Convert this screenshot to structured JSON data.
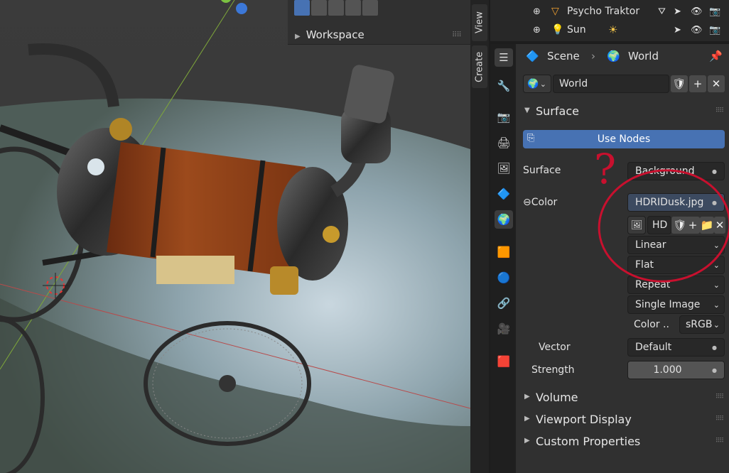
{
  "viewport": {
    "workspace_label": "Workspace"
  },
  "side_tabs": {
    "view": "View",
    "create": "Create"
  },
  "outliner": {
    "rows": [
      {
        "name": "Psycho Traktor"
      },
      {
        "name": "Sun"
      }
    ]
  },
  "properties": {
    "breadcrumb": {
      "scene": "Scene",
      "world": "World"
    },
    "world_name": "World",
    "surface_section": "Surface",
    "use_nodes_label": "Use Nodes",
    "surface_label": "Surface",
    "surface_value": "Background",
    "color_label": "Color",
    "color_value": "HDRIDusk.jpg",
    "image_name": "HD",
    "interpolation": "Linear",
    "projection": "Flat",
    "extension": "Repeat",
    "source": "Single Image",
    "color_space_label": "Color ..",
    "color_space_value": "sRGB",
    "vector_label": "Vector",
    "vector_value": "Default",
    "strength_label": "Strength",
    "strength_value": "1.000",
    "volume_section": "Volume",
    "viewport_display_section": "Viewport Display",
    "custom_properties_section": "Custom Properties"
  },
  "annotation": {
    "text": "?",
    "color": "#c8102e"
  },
  "colors": {
    "accent": "#4772b3",
    "panel": "#303030",
    "field": "#282828"
  }
}
